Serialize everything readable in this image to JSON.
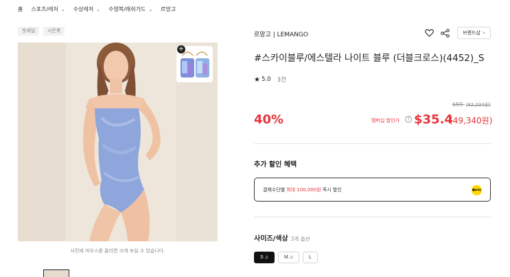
{
  "breadcrumb": [
    {
      "label": "홈",
      "has_dropdown": false
    },
    {
      "label": "스포츠/레저",
      "has_dropdown": true
    },
    {
      "label": "수상레저",
      "has_dropdown": true
    },
    {
      "label": "수영복/래쉬가드",
      "has_dropdown": true
    },
    {
      "label": "르망고",
      "has_dropdown": false
    }
  ],
  "tags": [
    "핫세일",
    "시즌룩"
  ],
  "image": {
    "caption": "사진에 마우스를 올리면 크게 보실 수 있습니다.",
    "plus": "+"
  },
  "product": {
    "brand": "르망고 | LEMANGO",
    "title": "#스카이블루/에스텔라 나이트 블루 (더블크로스)(4452)_S",
    "rating": "5.0",
    "review_count": "3건",
    "brand_shop_label": "브랜드샵"
  },
  "price": {
    "original_usd": "$59",
    "original_krw": "(82,234원)",
    "discount": "40%",
    "member_label": "멤버십 할인가",
    "help": "?",
    "sale_usd": "$35.4",
    "sale_krw": "(49,340원)"
  },
  "benefits": {
    "title": "추가 할인 혜택",
    "text_before": "결제수단별",
    "text_highlight": "최대 100,000원",
    "text_after": "즉시 할인",
    "pay_label": "●pay"
  },
  "options": {
    "title": "사이즈/색상",
    "subtitle": "3개 옵션",
    "sizes": [
      {
        "label": "S",
        "active": true
      },
      {
        "label": "M",
        "active": false
      },
      {
        "label": "L",
        "active": false
      }
    ]
  },
  "colors": {
    "accent_red": "#e8343a",
    "swimsuit_blue": "#8fa6dc"
  }
}
